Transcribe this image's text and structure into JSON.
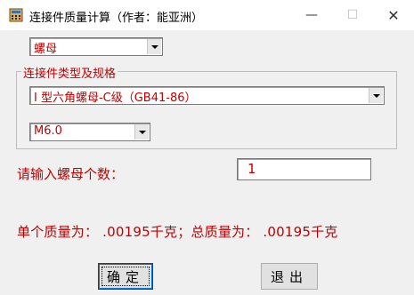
{
  "window": {
    "title": "连接件质量计算（作者：能亚洲）",
    "minimize_glyph": "—",
    "maximize_glyph": "☐",
    "close_glyph": "✕",
    "icon": "calculator-app-icon"
  },
  "part_select": {
    "value": "螺母"
  },
  "spec_group": {
    "legend": "连接件类型及规格",
    "type_select": {
      "value": "I 型六角螺母-C级（GB41-86）"
    },
    "size_select": {
      "value": "M6.0"
    }
  },
  "quantity": {
    "label": "请输入螺母个数：",
    "value": "1"
  },
  "result": {
    "text": "单个质量为： .00195千克；总质量为： .00195千克"
  },
  "buttons": {
    "ok": "确定",
    "exit": "退出"
  },
  "colors": {
    "accent_text": "#c00000",
    "window_bg": "#f0f0f0"
  }
}
